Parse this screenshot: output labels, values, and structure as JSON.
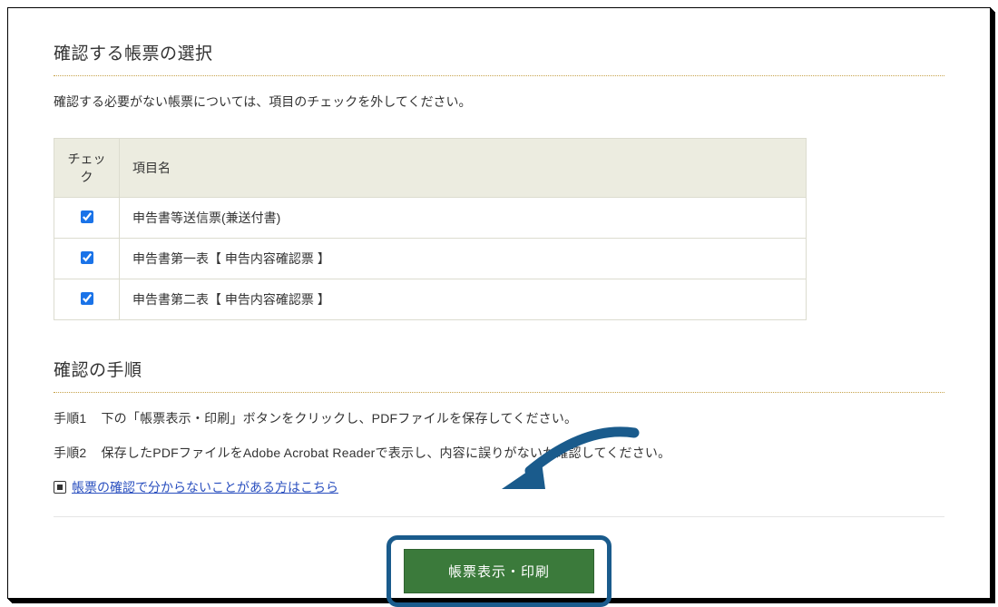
{
  "section1": {
    "title": "確認する帳票の選択",
    "hint": "確認する必要がない帳票については、項目のチェックを外してください。"
  },
  "table": {
    "headers": {
      "check": "チェック",
      "name": "項目名"
    },
    "rows": [
      {
        "checked": true,
        "name": "申告書等送信票(兼送付書)"
      },
      {
        "checked": true,
        "name": "申告書第一表【 申告内容確認票 】"
      },
      {
        "checked": true,
        "name": "申告書第二表【 申告内容確認票 】"
      }
    ]
  },
  "section2": {
    "title": "確認の手順",
    "steps": [
      {
        "label": "手順1",
        "text": "下の「帳票表示・印刷」ボタンをクリックし、PDFファイルを保存してください。"
      },
      {
        "label": "手順2",
        "text": "保存したPDFファイルをAdobe Acrobat Readerで表示し、内容に誤りがないか確認してください。"
      }
    ],
    "help_link": "帳票の確認で分からないことがある方はこちら"
  },
  "button": {
    "label": "帳票表示・印刷"
  }
}
